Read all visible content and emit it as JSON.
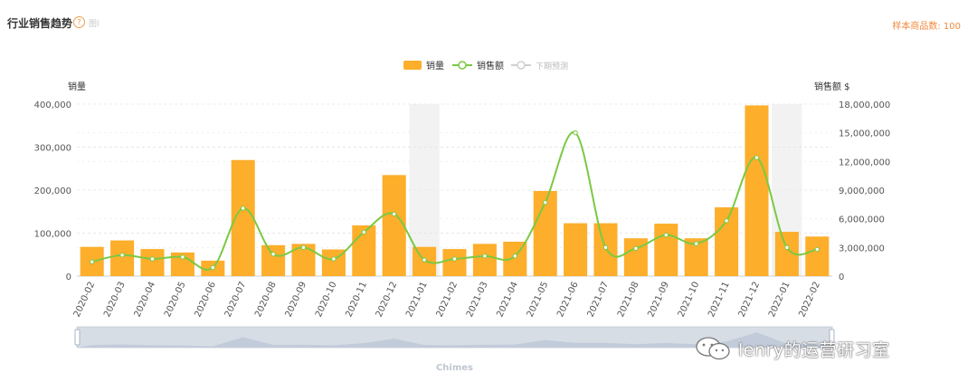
{
  "header": {
    "title": "行业销售趋势",
    "title_tag": "图l",
    "sample_label": "样本商品数: 100"
  },
  "colors": {
    "bar": "#fdae2b",
    "line": "#7ac943",
    "forecast": "#cfcfcf",
    "axis_text": "#555555",
    "accent": "#f08a3c"
  },
  "chart_data": {
    "type": "bar",
    "categories": [
      "2020-02",
      "2020-03",
      "2020-04",
      "2020-05",
      "2020-06",
      "2020-07",
      "2020-08",
      "2020-09",
      "2020-10",
      "2020-11",
      "2020-12",
      "2021-01",
      "2021-02",
      "2021-03",
      "2021-04",
      "2021-05",
      "2021-06",
      "2021-07",
      "2021-08",
      "2021-09",
      "2021-10",
      "2021-11",
      "2021-12",
      "2022-01",
      "2022-02"
    ],
    "series": [
      {
        "name": "销量",
        "type": "bar",
        "axis": "left",
        "values": [
          68000,
          83000,
          63000,
          55000,
          36000,
          270000,
          72000,
          75000,
          62000,
          118000,
          235000,
          68000,
          63000,
          75000,
          80000,
          198000,
          123000,
          123000,
          88000,
          122000,
          88000,
          160000,
          397000,
          103000,
          92000
        ]
      },
      {
        "name": "销售额",
        "type": "line",
        "axis": "right",
        "values": [
          1500000,
          2200000,
          1800000,
          2000000,
          900000,
          7100000,
          2300000,
          3000000,
          1800000,
          4600000,
          6500000,
          1700000,
          1800000,
          2100000,
          2100000,
          7700000,
          15000000,
          3000000,
          2900000,
          4300000,
          3400000,
          5800000,
          12400000,
          3000000,
          2800000
        ]
      },
      {
        "name": "下期预测",
        "type": "line",
        "axis": "right",
        "values": []
      }
    ],
    "highlight_categories": [
      "2021-01",
      "2022-01"
    ],
    "ylabel_left": "销量",
    "ylabel_right": "销售额 $",
    "ylim_left": [
      0,
      400000
    ],
    "yticks_left": [
      "400,000",
      "300,000",
      "200,000",
      "100,000",
      "0"
    ],
    "ylim_right": [
      0,
      18000000
    ],
    "yticks_right": [
      "18,000,000",
      "15,000,000",
      "12,000,000",
      "9,000,000",
      "6,000,000",
      "3,000,000",
      "0"
    ],
    "grid": true,
    "legend_position": "top-center",
    "brush_label": "Chimes"
  },
  "watermark": {
    "icon": "wechat-icon",
    "text": "lenry的运营研习室"
  }
}
